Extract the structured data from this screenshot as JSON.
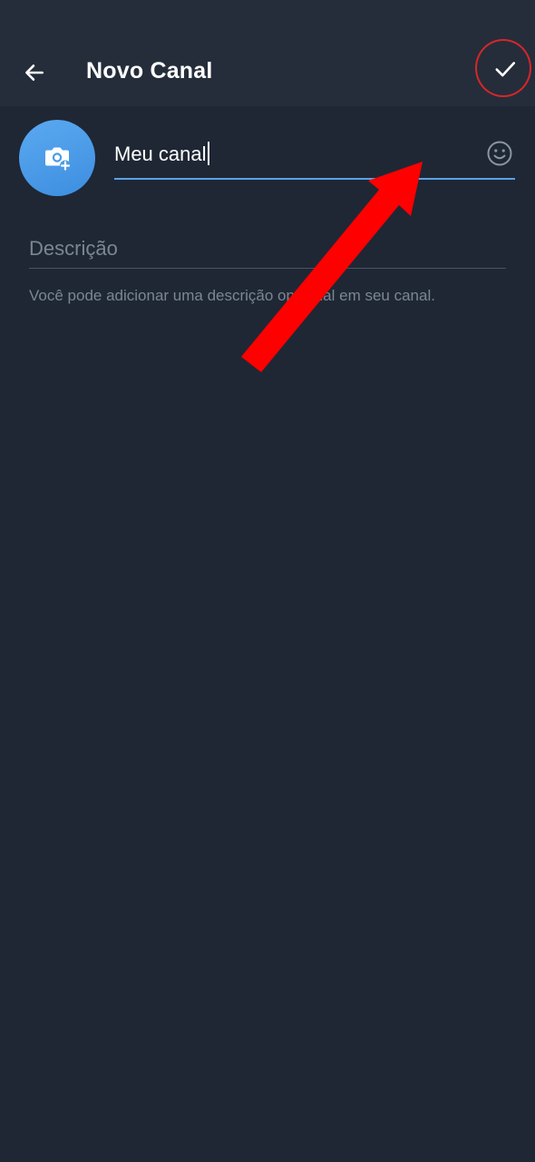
{
  "header": {
    "title": "Novo Canal",
    "back_icon": "arrow-left-icon",
    "done_icon": "check-icon"
  },
  "channel_form": {
    "avatar_icon": "camera-add-icon",
    "name_value": "Meu canal",
    "emoji_icon": "emoji-icon",
    "description_placeholder": "Descrição",
    "hint": "Você pode adicionar uma descrição opcional em seu canal."
  },
  "colors": {
    "background": "#1f2734",
    "appbar": "#252d3a",
    "accent": "#5ba2e6",
    "avatar": "#4b9be6",
    "annotation": "#ff0000",
    "highlight_ring": "#d7262a"
  }
}
